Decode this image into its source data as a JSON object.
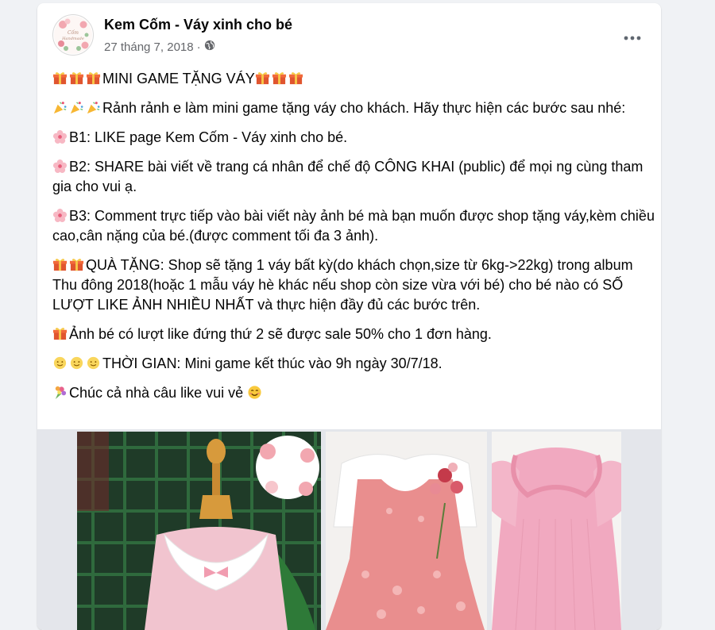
{
  "post": {
    "page_name": "Kem Cốm - Váy xinh cho bé",
    "date": "27 tháng 7, 2018",
    "privacy_icon": "globe-icon",
    "more_icon": "more-horizontal-icon",
    "avatar_logo_text": [
      "Cốm",
      "Handmade"
    ]
  },
  "content": {
    "title": "MINI GAME TẶNG VÁY",
    "intro": "Rảnh rảnh e làm mini game tặng váy cho khách. Hãy thực hiện các bước sau nhé:",
    "b1": "B1: LIKE page Kem Cốm - Váy xinh cho bé.",
    "b2": "B2: SHARE bài viết về trang cá nhân để chế độ CÔNG KHAI (public) để mọi ng cùng tham gia cho vui ạ.",
    "b3": "B3: Comment trực tiếp vào bài viết này ảnh bé mà bạn muốn được shop tặng váy,kèm chiều cao,cân nặng của bé.(được comment tối đa 3 ảnh).",
    "gift": "QUÀ TẶNG: Shop sẽ tặng 1 váy bất kỳ(do khách chọn,size từ 6kg->22kg) trong album Thu đông 2018(hoặc 1 mẫu váy hè khác nếu shop còn size vừa với bé) cho bé nào có SỐ LƯỢT LIKE ẢNH NHIỀU NHẤT và thực hiện đầy đủ các bước trên.",
    "second": "Ảnh bé có lượt like đứng thứ 2 sẽ được sale 50% cho 1 đơn hàng.",
    "time": "THỜI GIAN: Mini game kết thúc vào 9h ngày 30/7/18.",
    "wish": "Chúc cả nhà câu like vui vẻ",
    "icons": {
      "gift": "gift-icon",
      "party": "party-popper-icon",
      "flower": "cherry-blossom-icon",
      "sun": "sun-face-icon",
      "bouquet": "bouquet-icon",
      "smile": "smiling-face-icon"
    }
  },
  "photos": [
    {
      "name": "photo-dress-mannequin"
    },
    {
      "name": "photo-floral-dress"
    },
    {
      "name": "photo-pink-dress"
    }
  ],
  "colors": {
    "text": "#050505",
    "secondary": "#65676b",
    "background": "#f0f2f5"
  }
}
